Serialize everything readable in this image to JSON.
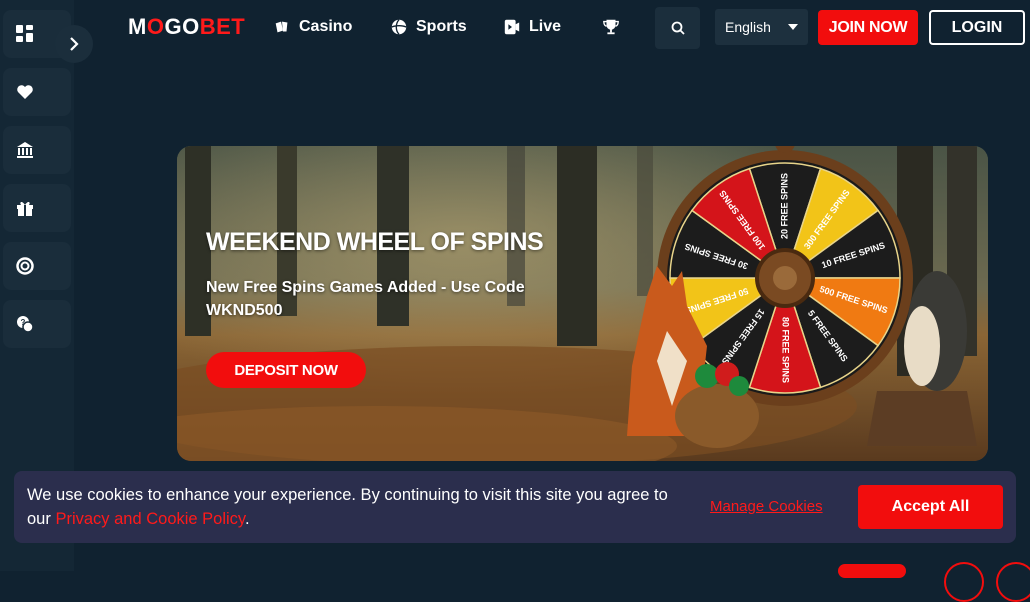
{
  "brand": {
    "logo_prefix": "M",
    "logo_o": "O",
    "logo_rest_white": "GO",
    "logo_red": "BET"
  },
  "nav": [
    {
      "label": "Casino",
      "icon": "cards-icon"
    },
    {
      "label": "Sports",
      "icon": "soccer-ball-icon"
    },
    {
      "label": "Live",
      "icon": "live-card-icon"
    },
    {
      "label": "",
      "icon": "trophy-icon"
    }
  ],
  "header": {
    "language": "English",
    "join_label": "JOIN NOW",
    "login_label": "LOGIN"
  },
  "sidebar": {
    "items": [
      {
        "icon": "grid-icon"
      },
      {
        "icon": "heart-icon"
      },
      {
        "icon": "bank-icon"
      },
      {
        "icon": "gift-icon"
      },
      {
        "icon": "chip-icon"
      },
      {
        "icon": "chat-icon"
      }
    ]
  },
  "banner": {
    "title": "WEEKEND WHEEL OF SPINS",
    "subtitle": "New Free Spins Games Added - Use Code WKND500",
    "cta": "DEPOSIT NOW",
    "wheel_segments": [
      "20 FREE SPINS",
      "300 FREE SPINS",
      "10 FREE SPINS",
      "500 FREE SPINS",
      "5 FREE SPINS",
      "80 FREE SPINS",
      "15 FREE SPINS",
      "50 FREE SPINS",
      "30 FREE SPINS",
      "100 FREE SPINS"
    ]
  },
  "cookie": {
    "text": "We use cookies to enhance your experience. By continuing to visit this site you agree to our ",
    "link": "Privacy and Cookie Policy",
    "suffix": ".",
    "manage": "Manage Cookies",
    "accept": "Accept All"
  },
  "colors": {
    "accent": "#f20d0d",
    "bg": "#102230",
    "sidebar": "#142735",
    "cookie_bg": "#2b2e4d"
  }
}
